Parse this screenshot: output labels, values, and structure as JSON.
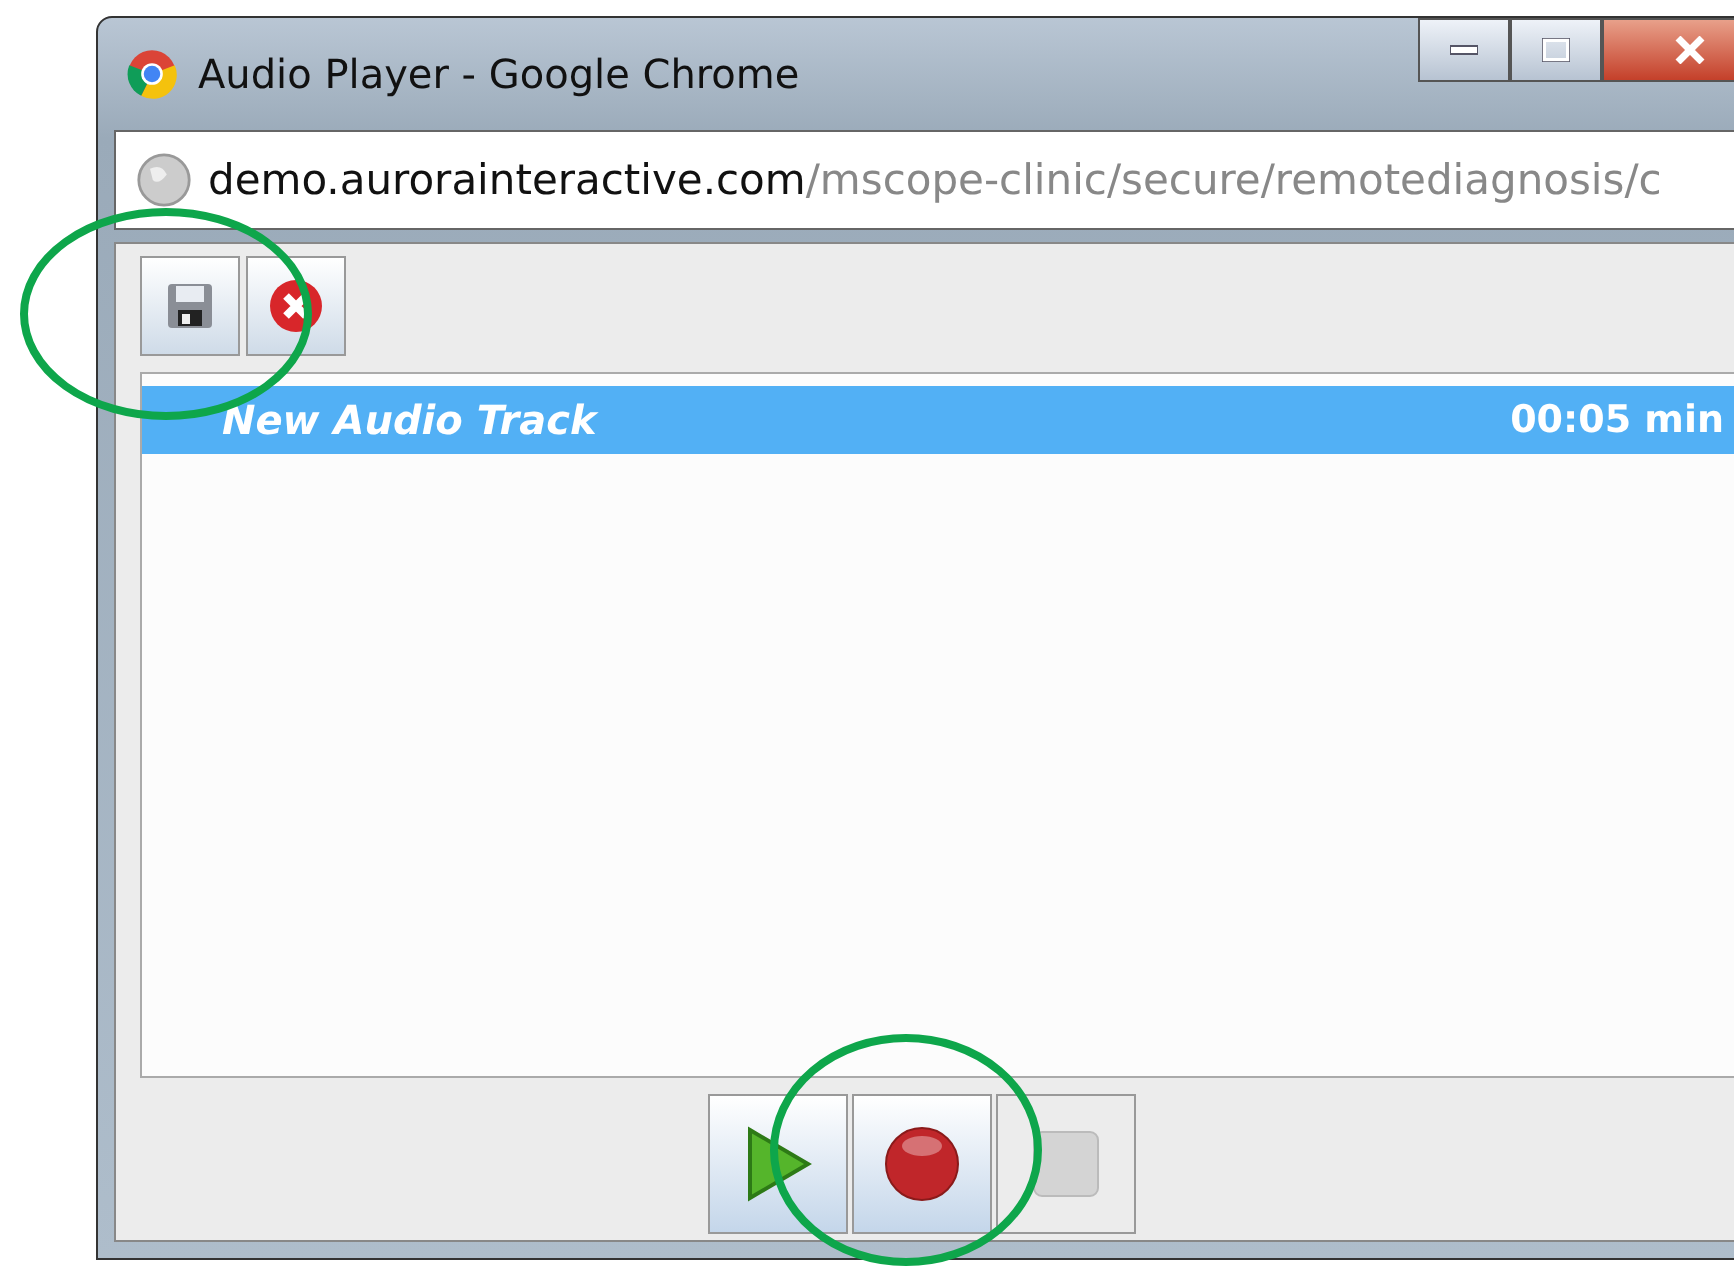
{
  "window": {
    "title": "Audio Player - Google Chrome"
  },
  "address": {
    "domain": "demo.aurorainteractive.com",
    "path": "/mscope-clinic/secure/remotediagnosis/c"
  },
  "toolbar": [
    {
      "kind": "save",
      "disabled": false
    },
    {
      "kind": "delete",
      "disabled": false
    }
  ],
  "tracks": [
    {
      "name": "New Audio Track",
      "duration": "00:05 min",
      "selected": true
    }
  ],
  "controls": [
    {
      "kind": "play",
      "disabled": false
    },
    {
      "kind": "record",
      "disabled": false
    },
    {
      "kind": "stop",
      "disabled": true
    }
  ]
}
